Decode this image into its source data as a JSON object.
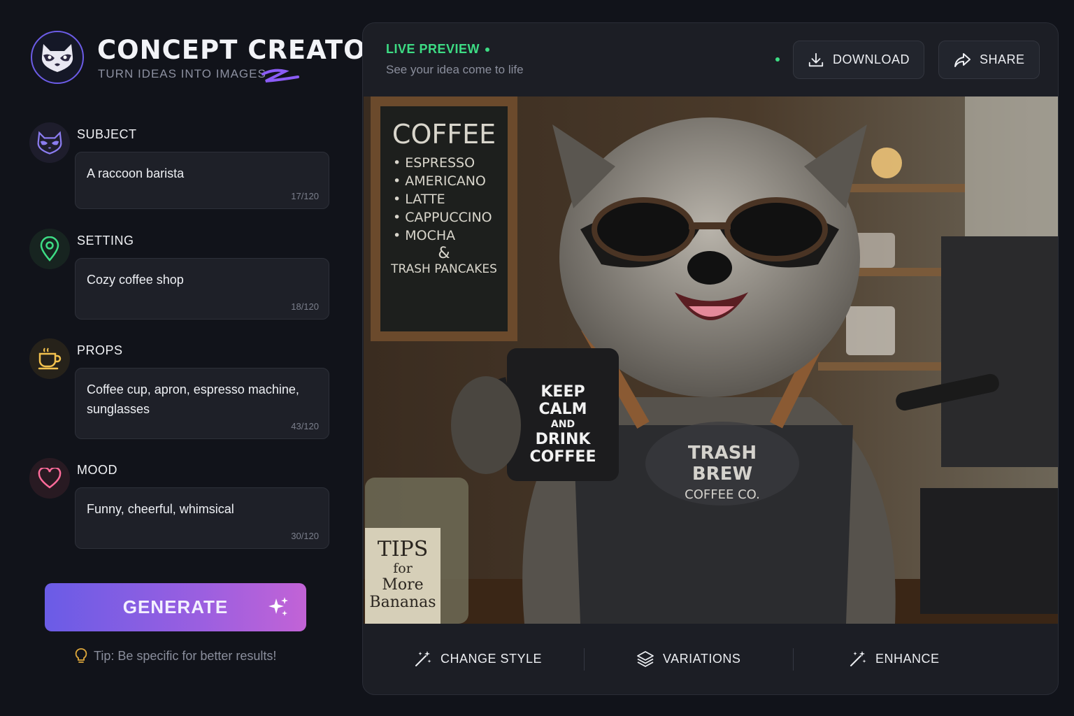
{
  "app": {
    "title": "CONCEPT CREATOR",
    "subtitle": "TURN IDEAS INTO IMAGES",
    "logo_icon": "raccoon-icon",
    "accent": "#6c5ce7"
  },
  "fields": [
    {
      "label": "SUBJECT",
      "value": "A raccoon barista",
      "count": "17/120",
      "icon": "raccoon-icon"
    },
    {
      "label": "SETTING",
      "value": "Cozy coffee shop",
      "count": "18/120",
      "icon": "location-pin-icon"
    },
    {
      "label": "PROPS",
      "value": "Coffee cup, apron, espresso machine, sunglasses",
      "count": "43/120",
      "icon": "coffee-cup-icon"
    },
    {
      "label": "MOOD",
      "value": "Funny, cheerful, whimsical",
      "count": "30/120",
      "icon": "heart-icon"
    }
  ],
  "generate": {
    "label": "GENERATE",
    "icon": "sparkle-icon"
  },
  "tip": {
    "text": "Tip: Be specific for better results!",
    "icon": "lightbulb-icon"
  },
  "preview": {
    "live_label": "LIVE PREVIEW",
    "subtitle": "See your idea come to life",
    "download_label": "DOWNLOAD",
    "share_label": "SHARE",
    "status_color": "#3ddc84",
    "image": {
      "chalkboard_title": "COFFEE",
      "chalkboard_items": [
        "• ESPRESSO",
        "• AMERICANO",
        "• LATTE",
        "• CAPPUCCINO",
        "• MOCHA"
      ],
      "chalkboard_amp": "&",
      "chalkboard_footer": "TRASH PANCAKES",
      "mug_lines": [
        "KEEP",
        "CALM",
        "AND",
        "DRINK",
        "COFFEE"
      ],
      "apron_brand": "TRASH BREW",
      "apron_sub": "COFFEE CO.",
      "tips_lines": [
        "TIPS",
        "for",
        "More",
        "Bananas"
      ]
    }
  },
  "actions": [
    {
      "label": "CHANGE STYLE",
      "icon": "magic-wand-icon"
    },
    {
      "label": "VARIATIONS",
      "icon": "layers-icon"
    },
    {
      "label": "ENHANCE",
      "icon": "magic-wand-icon"
    }
  ]
}
